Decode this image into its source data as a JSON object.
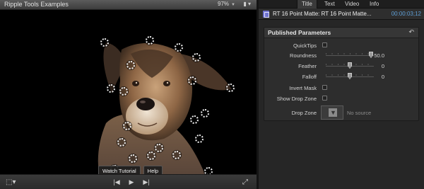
{
  "viewer": {
    "title": "Ripple Tools Examples",
    "zoom": "97%",
    "view_menu": "▮ ▾",
    "overlay_buttons": {
      "watch": "Watch Tutorial",
      "help": "Help"
    },
    "control_point_count": 20,
    "transport": {
      "prev": "|◀",
      "play": "▶",
      "next": "▶|"
    }
  },
  "inspector": {
    "tabs": [
      {
        "label": "Title",
        "active": true
      },
      {
        "label": "Text",
        "active": false
      },
      {
        "label": "Video",
        "active": false
      },
      {
        "label": "Info",
        "active": false
      }
    ],
    "clip": {
      "name": "RT 16 Point Matte: RT 16 Point Matte...",
      "timecode": "00:00:03;12"
    },
    "section": {
      "title": "Published Parameters",
      "reset_icon": "reset-arrow-icon",
      "params": {
        "quicktips": {
          "label": "QuickTips",
          "checked": false
        },
        "roundness": {
          "label": "Roundness",
          "value": "50.0",
          "slider": 0.99
        },
        "feather": {
          "label": "Feather",
          "value": "0",
          "slider": 0.5
        },
        "falloff": {
          "label": "Falloff",
          "value": "0",
          "slider": 0.5
        },
        "invert_mask": {
          "label": "Invert Mask",
          "checked": false
        },
        "show_drop_zone": {
          "label": "Show Drop Zone",
          "checked": false
        },
        "drop_zone": {
          "label": "Drop Zone",
          "status": "No source"
        }
      }
    }
  },
  "colors": {
    "timecode": "#5f9fd6",
    "clip_icon": "#6f72cf"
  }
}
